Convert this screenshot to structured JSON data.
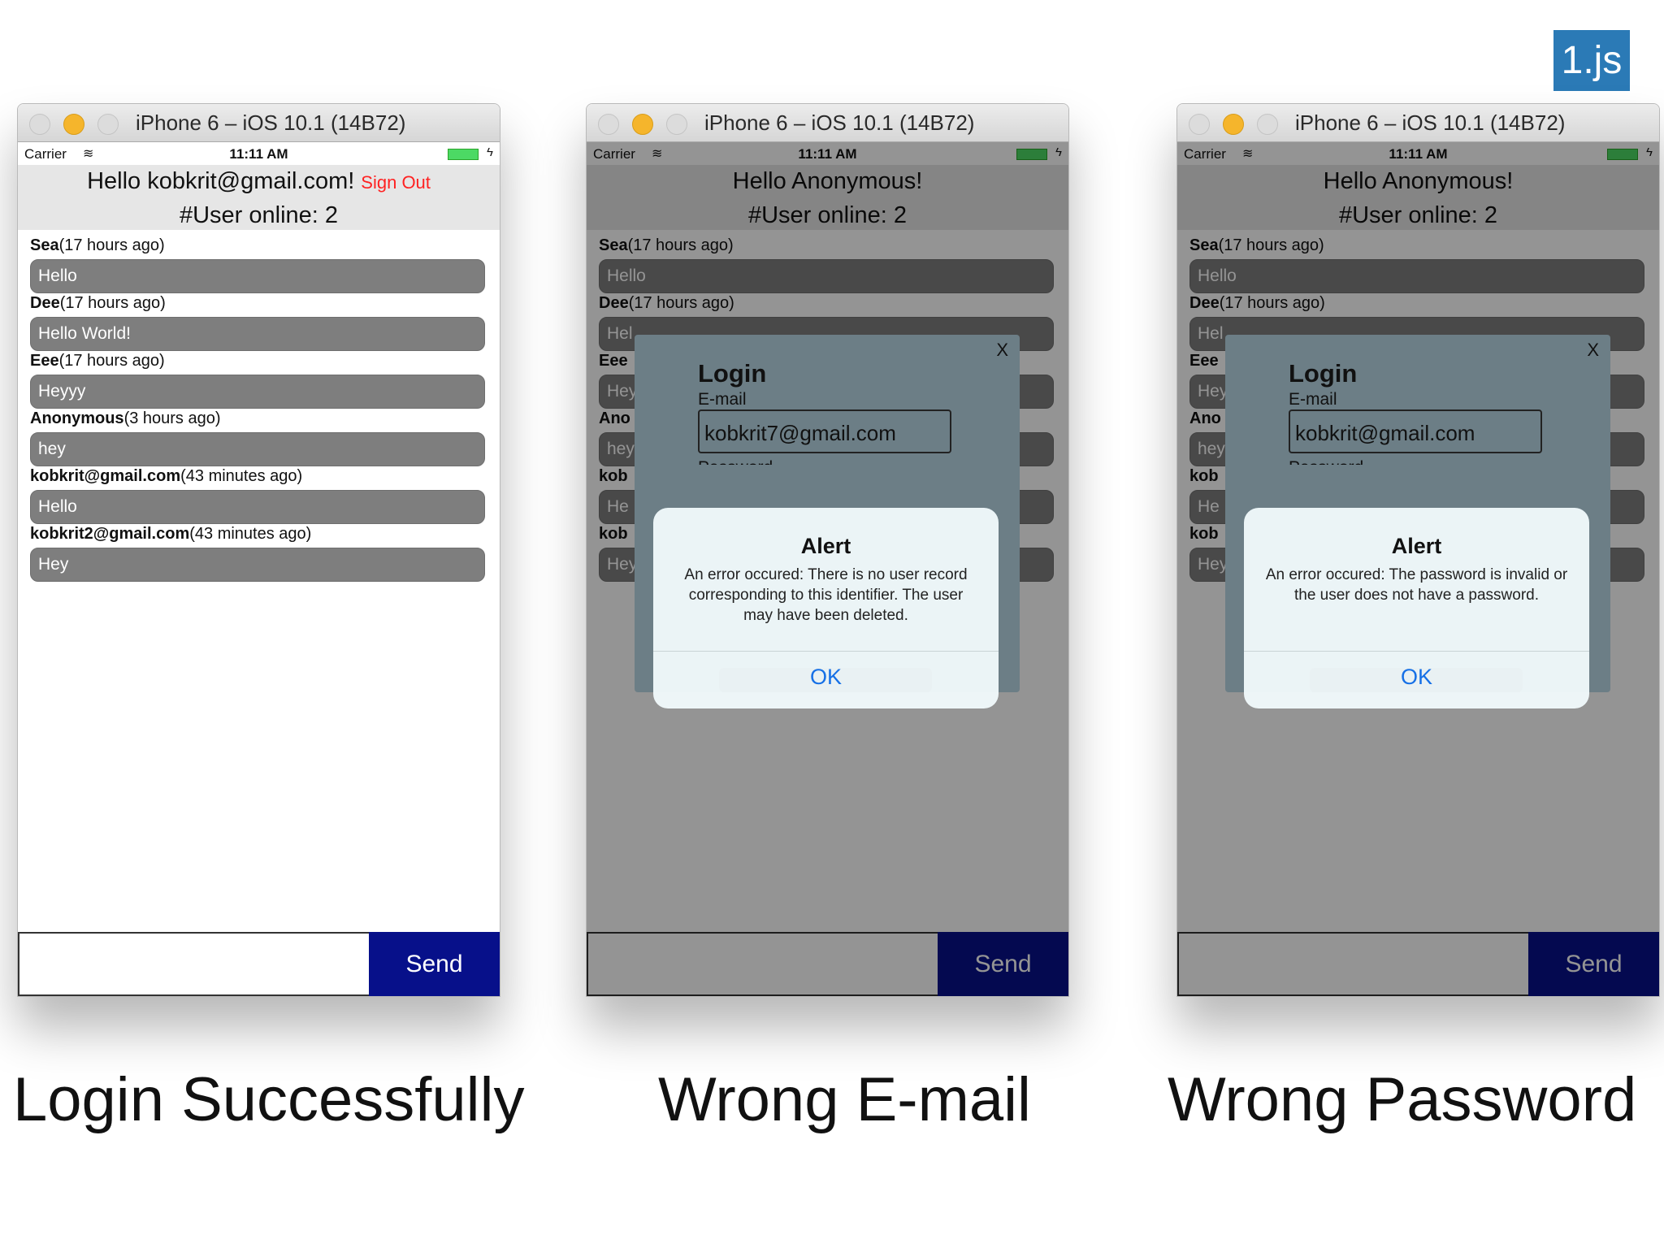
{
  "badge": "1.js",
  "simulators": [
    {
      "title": "iPhone 6 – iOS 10.1 (14B72)",
      "status": {
        "carrier": "Carrier",
        "time": "11:11 AM"
      },
      "greeting": "Hello kobkrit@gmail.com!",
      "sign_out": "Sign Out",
      "online": "#User online: 2",
      "messages": [
        {
          "user": "Sea",
          "time": "(17 hours ago)",
          "text": "Hello"
        },
        {
          "user": "Dee",
          "time": "(17 hours ago)",
          "text": "Hello World!"
        },
        {
          "user": "Eee",
          "time": "(17 hours ago)",
          "text": "Heyyy"
        },
        {
          "user": "Anonymous",
          "time": "(3 hours ago)",
          "text": "hey"
        },
        {
          "user": "kobkrit@gmail.com",
          "time": "(43 minutes ago)",
          "text": "Hello"
        },
        {
          "user": "kobkrit2@gmail.com",
          "time": "(43 minutes ago)",
          "text": "Hey"
        }
      ],
      "send": "Send"
    },
    {
      "title": "iPhone 6 – iOS 10.1 (14B72)",
      "status": {
        "carrier": "Carrier",
        "time": "11:11 AM"
      },
      "greeting": "Hello Anonymous!",
      "online": "#User online: 2",
      "messages": [
        {
          "user": "Sea",
          "time": "(17 hours ago)",
          "text": "Hello"
        },
        {
          "user": "Dee",
          "time": "(17 hours ago)",
          "text": "Hel"
        },
        {
          "user": "Eee",
          "time": "",
          "text": "Hey"
        },
        {
          "user": "Ano",
          "time": "",
          "text": "hey"
        },
        {
          "user": "kob",
          "time": "",
          "text": "He"
        },
        {
          "user": "kob",
          "time": "",
          "text": "Hey"
        }
      ],
      "login": {
        "close": "X",
        "title": "Login",
        "email_label": "E-mail",
        "email_value": "kobkrit7@gmail.com",
        "password_label": "Password"
      },
      "alert": {
        "title": "Alert",
        "message": "An error occured: There is no user record corresponding to this identifier. The user may have been deleted.",
        "ok": "OK"
      },
      "send": "Send"
    },
    {
      "title": "iPhone 6 – iOS 10.1 (14B72)",
      "status": {
        "carrier": "Carrier",
        "time": "11:11 AM"
      },
      "greeting": "Hello Anonymous!",
      "online": "#User online: 2",
      "messages": [
        {
          "user": "Sea",
          "time": "(17 hours ago)",
          "text": "Hello"
        },
        {
          "user": "Dee",
          "time": "(17 hours ago)",
          "text": "Hel"
        },
        {
          "user": "Eee",
          "time": "",
          "text": "Hey"
        },
        {
          "user": "Ano",
          "time": "",
          "text": "hey"
        },
        {
          "user": "kob",
          "time": "",
          "text": "He"
        },
        {
          "user": "kob",
          "time": "",
          "text": "Hey"
        }
      ],
      "login": {
        "close": "X",
        "title": "Login",
        "email_label": "E-mail",
        "email_value": "kobkrit@gmail.com",
        "password_label": "Password"
      },
      "alert": {
        "title": "Alert",
        "message": "An error occured: The password is invalid or the user does not have a password.",
        "ok": "OK"
      },
      "send": "Send"
    }
  ],
  "captions": [
    "Login Successfully",
    "Wrong E-mail",
    "Wrong Password"
  ],
  "colors": {
    "send_button": "#07108a",
    "sign_out": "#ff2222",
    "badge": "#2b7ab6",
    "ok": "#1670e6"
  }
}
